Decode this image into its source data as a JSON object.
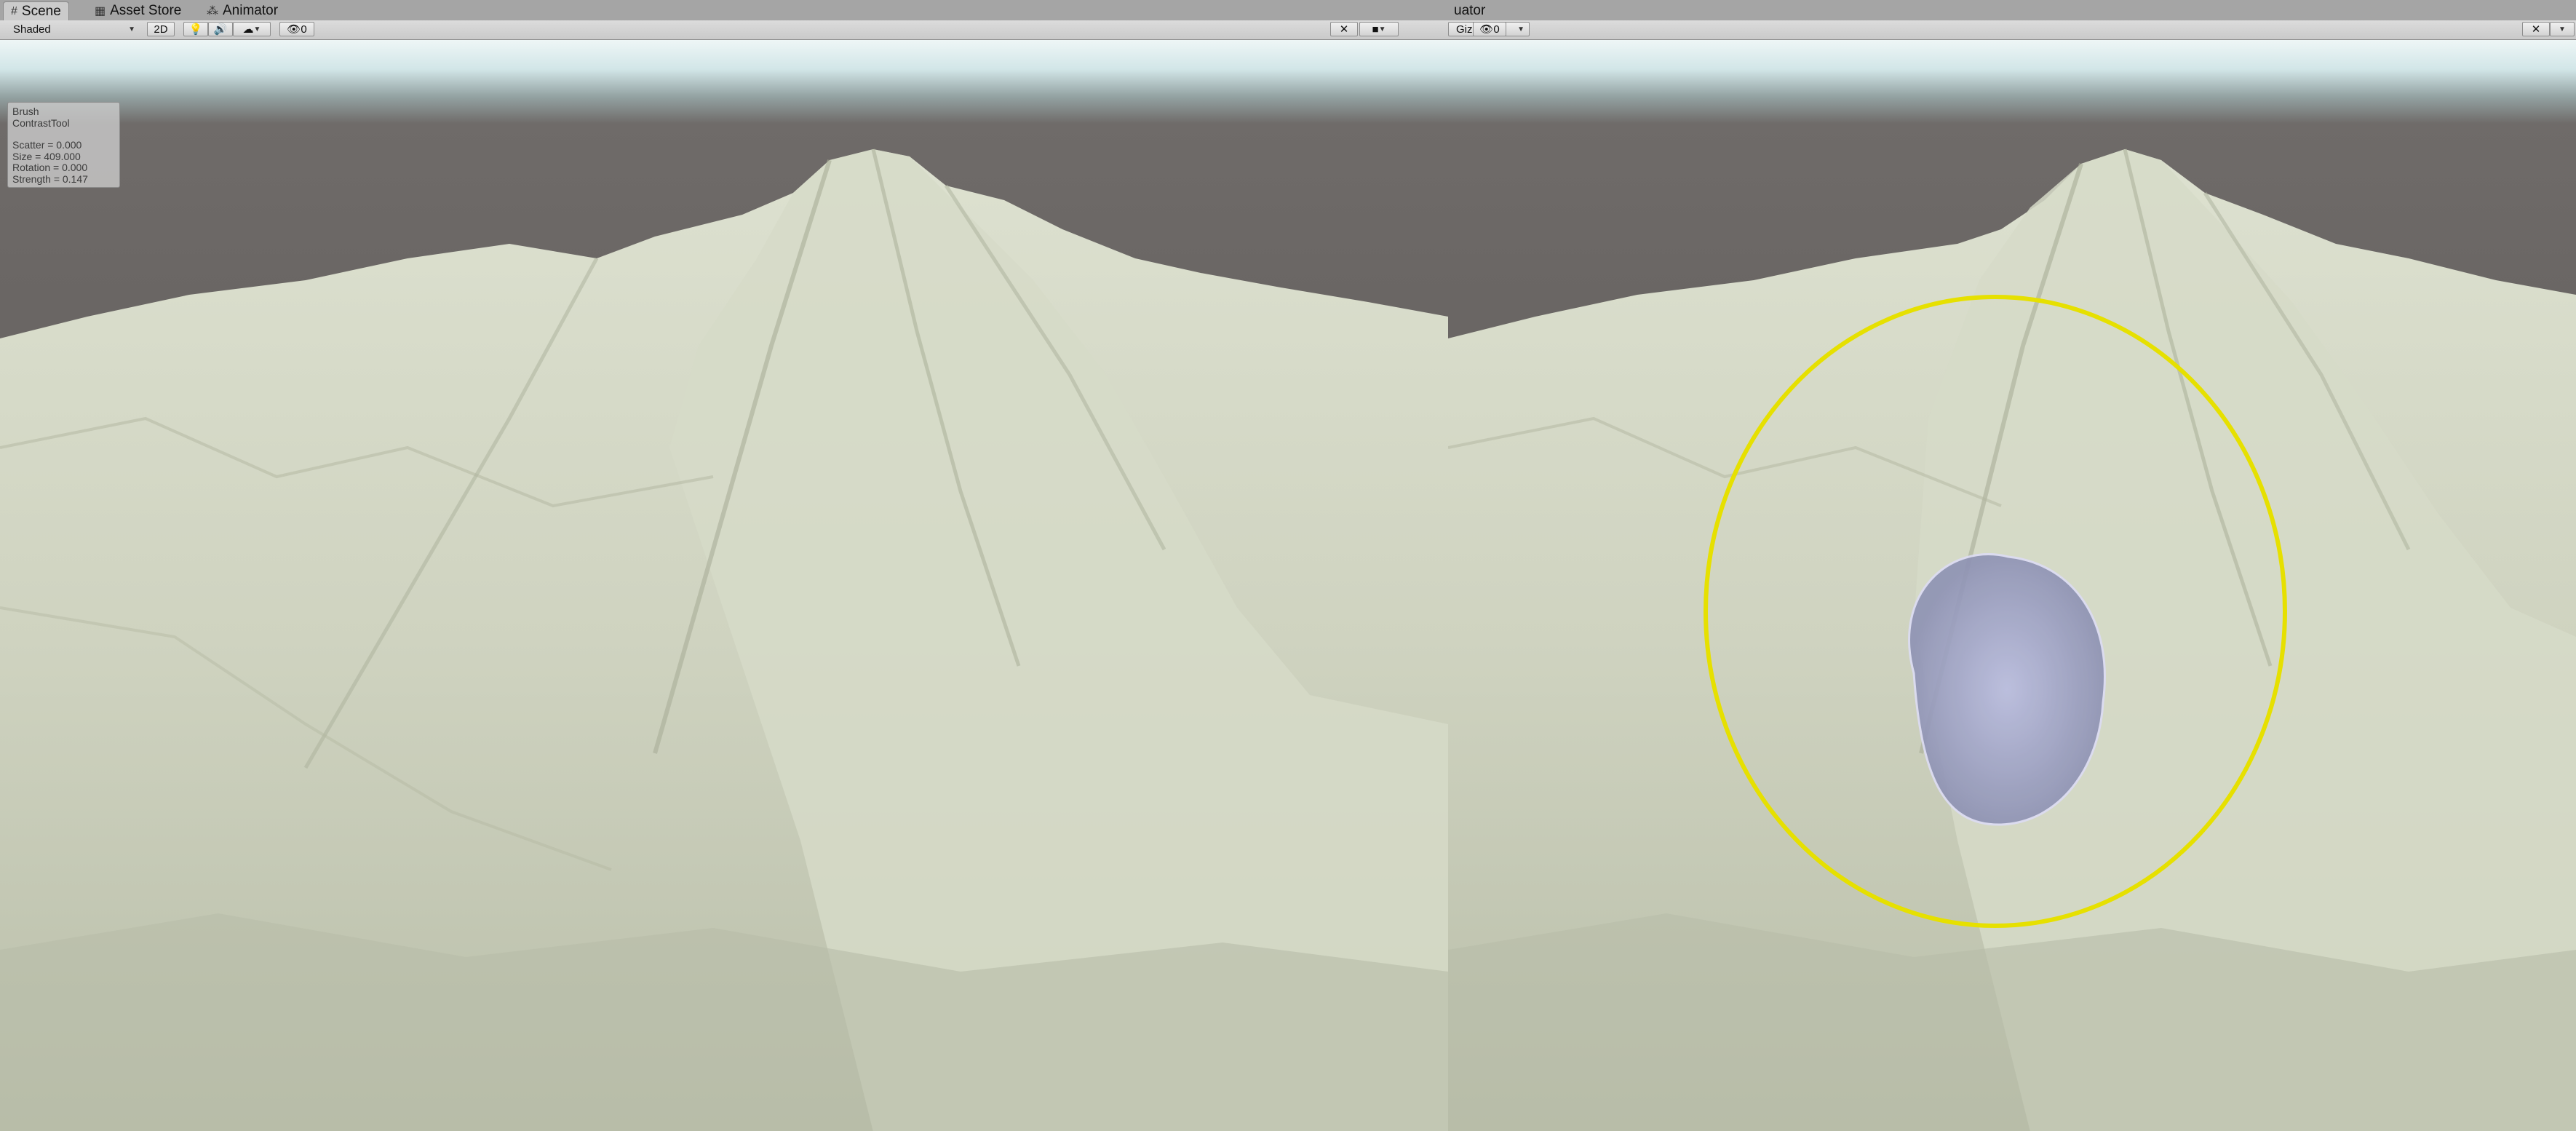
{
  "left_pane": {
    "tabs": [
      {
        "label": "Scene",
        "icon": "scene-grid-icon"
      },
      {
        "label": "Asset Store",
        "icon": "asset-store-icon"
      },
      {
        "label": "Animator",
        "icon": "animator-icon"
      }
    ],
    "toolbar": {
      "draw_mode": "Shaded",
      "two_d_label": "2D",
      "hidden_count": "0"
    },
    "brush_panel": {
      "title": "Brush",
      "tool": "ContrastTool",
      "scatter": "Scatter = 0.000",
      "size": "Size = 409.000",
      "rotation": "Rotation = 0.000",
      "strength": "Strength = 0.147"
    }
  },
  "right_pane": {
    "tab_fragment": "uator",
    "toolbar": {
      "gizmos_label": "Gizmos",
      "hidden_count": "0"
    },
    "brush_overlay": {
      "outer_ring_color": "#e6e000",
      "inner_preview_color": "#8f94b8"
    }
  },
  "colors": {
    "terrain": "#c9ceba",
    "sky_band": "#e6f2f2",
    "horizon": "#6a6664"
  }
}
